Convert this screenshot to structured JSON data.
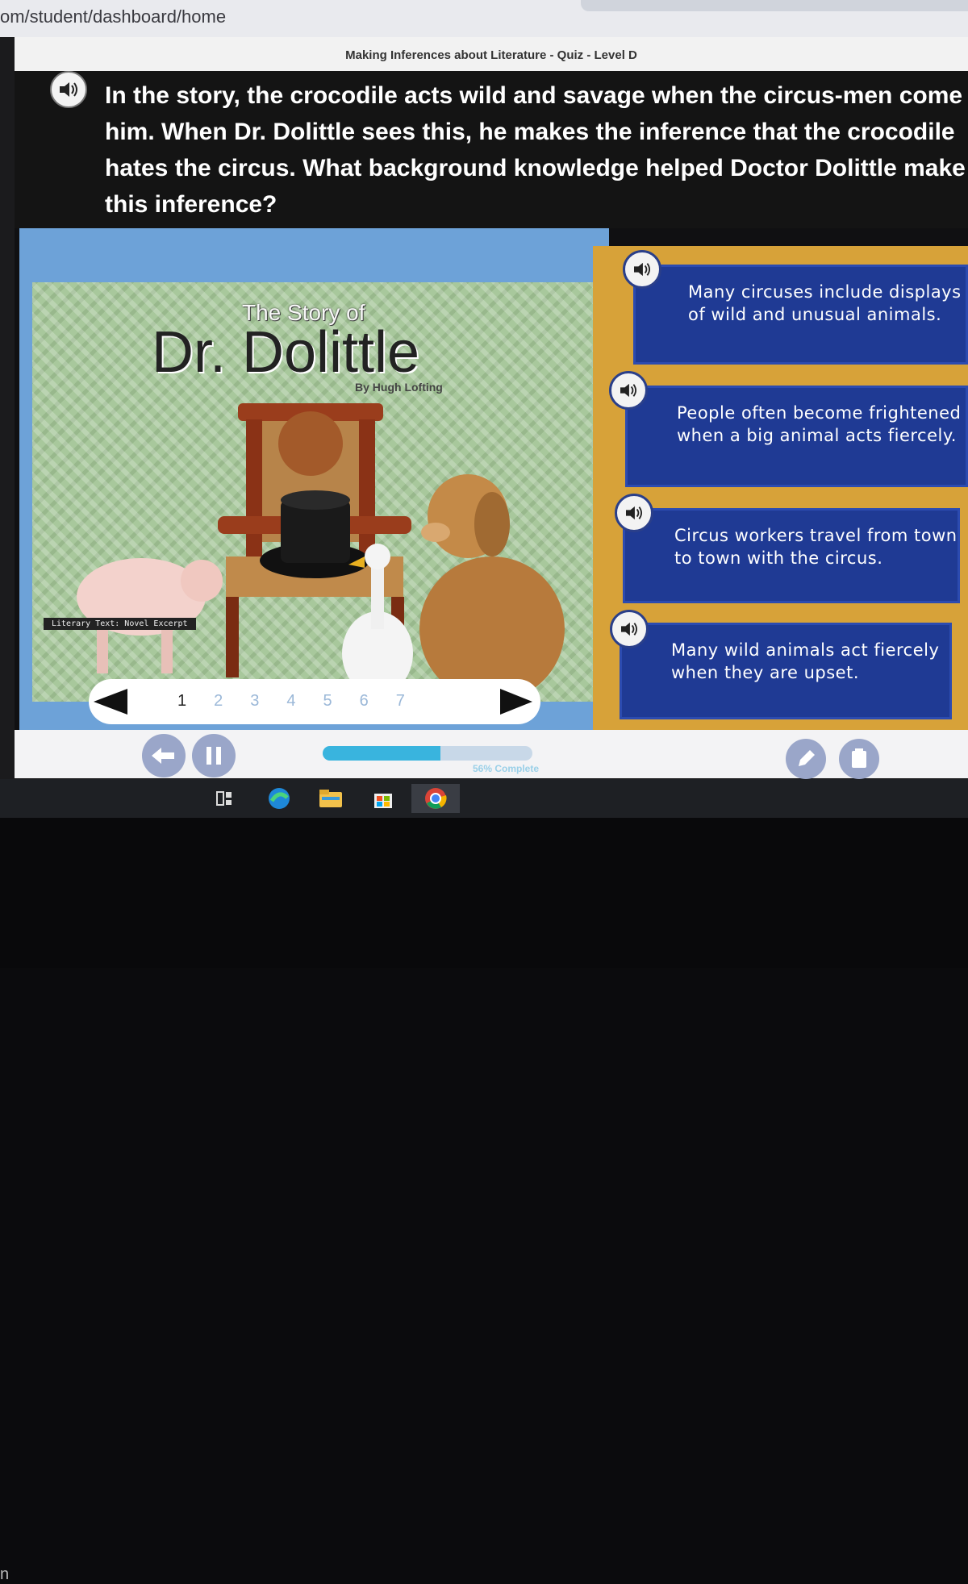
{
  "browser": {
    "url": "om/student/dashboard/home"
  },
  "quiz": {
    "title": "Making Inferences about Literature - Quiz - Level D",
    "question_lines": [
      "In the story, the crocodile acts wild and savage when the circus-men come",
      "him. When Dr. Dolittle sees this, he makes the inference that the crocodile",
      "hates the circus. What background knowledge helped Doctor Dolittle make",
      "this inference?"
    ]
  },
  "book": {
    "story_of": "The Story of",
    "title": "Dr. Dolittle",
    "author": "By Hugh Lofting",
    "tag": "Literary Text: Novel Excerpt"
  },
  "pager": {
    "pages": [
      "1",
      "2",
      "3",
      "4",
      "5",
      "6",
      "7"
    ],
    "current": "1"
  },
  "answers": [
    "Many circuses include displays of wild and unusual animals.",
    "People often become frightened when a big animal acts fiercely.",
    "Circus workers travel from town to town with the circus.",
    "Many wild animals act fiercely when they are upset."
  ],
  "progress": {
    "label": "56% Complete",
    "value": 0.56
  },
  "taskbar": {
    "edge_char": "n"
  },
  "icons": [
    "speaker-icon",
    "back-arrow-icon",
    "pause-icon",
    "pencil-icon",
    "notepad-icon",
    "task-view-icon",
    "edge-browser-icon",
    "file-explorer-icon",
    "store-icon",
    "chrome-icon"
  ],
  "colors": {
    "answer_bg": "#1f3a94",
    "panel_gold": "#d7a239",
    "content_blue": "#6da2d8",
    "progress_fill": "#39b4de"
  }
}
